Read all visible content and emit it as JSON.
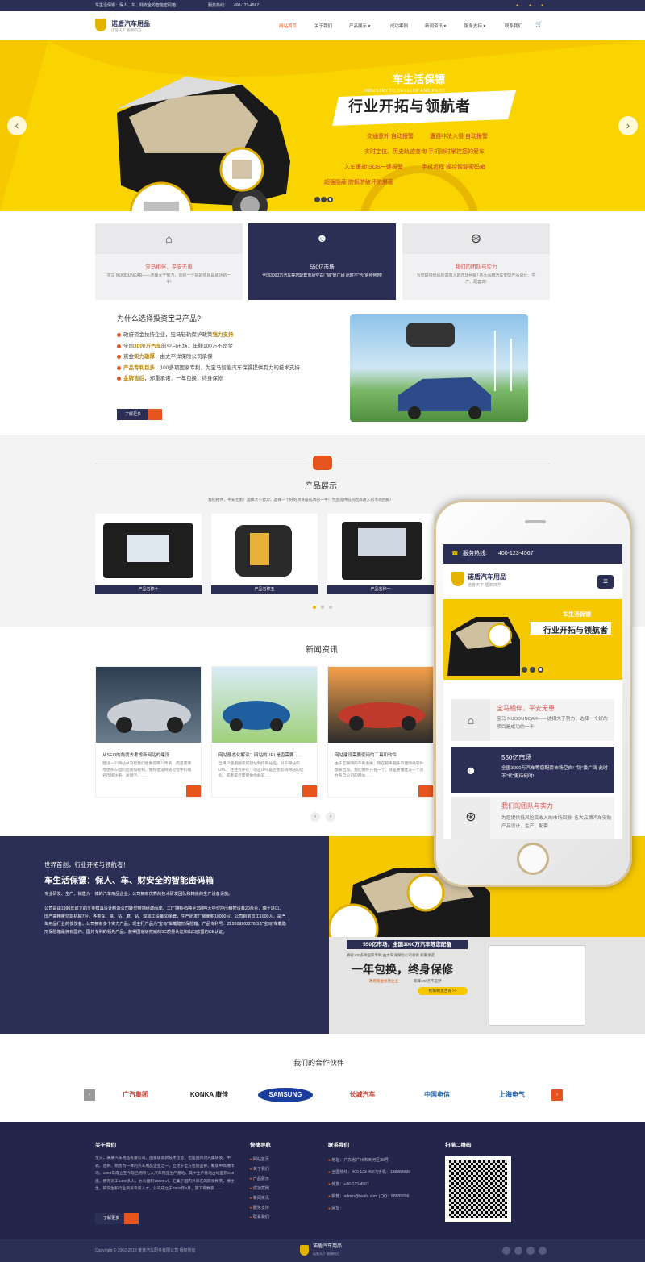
{
  "topbar": {
    "slogan": "车生活保镖：保人、车、财安全的智能密码箱！",
    "hotline_label": "服务热线：",
    "hotline": "400-123-4567"
  },
  "header": {
    "logo_title": "诺盾汽车用品",
    "logo_sub": "诺誉天下 盾御四方"
  },
  "nav": [
    {
      "label": "网站首页"
    },
    {
      "label": "关于我们"
    },
    {
      "label": "产品展示 ▾"
    },
    {
      "label": "成功案例"
    },
    {
      "label": "新闻资讯 ▾"
    },
    {
      "label": "服务支持 ▾"
    },
    {
      "label": "联系我们"
    }
  ],
  "banner": {
    "tag": "车生活保镖",
    "en": "INDUSTRY TO DEVELOP AND PILOT",
    "headline": "行业开拓与领航者",
    "features": [
      "交通意外 自动报警",
      "遭遇非法入侵 自动报警",
      "实时定位、历史轨迹查询",
      "手机随时掌控您的爱车",
      "入车遭劫 SOS一键报警",
      "手机远程 操控智能密码箱",
      "超强隐蔽 防拆防破坏防屏蔽"
    ],
    "current_slide": 3,
    "slide_count": 3
  },
  "features": [
    {
      "title": "宝马相伴，平安无患",
      "text": "宝马 NUODUNCAR——选择大于努力，选择一个好的项目是成功的一半!"
    },
    {
      "title": "550亿市场",
      "text": "全国3000万汽车等您配套市场空白! \"钱\"景广阔 此时不\"代\"更待何时!"
    },
    {
      "title": "我们的团队与实力",
      "text": "为您提供低风险高收入的市场回报! 各大品牌汽车安防产品设计、生产、配套商!"
    }
  ],
  "why": {
    "title": "为什么选择投资宝马产品?",
    "items": [
      {
        "pre": "政府资金扶持企业，宝马轻轨保护政策",
        "hl": "强力支持",
        "post": ""
      },
      {
        "pre": "全国",
        "hl": "3000万汽车",
        "post": "的空白市场，年赚100万不是梦"
      },
      {
        "pre": "资金",
        "hl": "实力雄厚",
        "post": "，由太平洋保险公司承保"
      },
      {
        "pre": "",
        "hl": "产品专利巨多",
        "post": "，100多项国家专利，为宝马智能汽车保镖提供有力的技术支持"
      },
      {
        "pre": "",
        "hl": "金牌售后",
        "post": "，郑重承诺：一年包换，终身保修"
      }
    ],
    "button": "了解更多"
  },
  "products": {
    "title": "产品展示",
    "intro": "我们相伴，平安无患！选择大于努力，选择一个好的项目是成功的一半！为您提供低风险高收入的市场回报！",
    "items": [
      {
        "name": "产品名称十"
      },
      {
        "name": "产品名称五"
      },
      {
        "name": "产品名称一"
      }
    ]
  },
  "news": {
    "title": "新闻资讯",
    "items": [
      {
        "title": "从SEO的角度去考虑新网站的建设",
        "text": "建设一个网站并没有我们想象得那么简单，而是需要考虑多方面的因素和规划。做好建设网站过程中的域名选择注册、关键字、……"
      },
      {
        "title": "网站静态化解读：网站的URL是否需要……",
        "text": "当用户使用搜索或建站制作网站后，对于网站的URL，往往会存在：动态URL是否会影响网站的优化，或者是否需要做伪静态……"
      },
      {
        "title": "网站建设需要使用的工具和软件",
        "text": "由于互联网的不断发展，现在越来越多的建网站软件都被出现。我们做好只有一个，就是要懂建设一个适合各自公司的网站……"
      }
    ]
  },
  "about": {
    "line1": "世界首创，行业开拓与领航者！",
    "line2": "车生活保镖：保人、车、财安全的智能密码箱",
    "p1": "专业研发、生产、销售为一体的汽车用品企业，公司拥有优秀的技术研发团队和精良的生产设备设施。",
    "p2": "公司是由1996年成立的五金模具设计制造公司转型带领组建而成。工厂拥有45吨至350吨大中型冲压精密设备20余台，瑞士进口、国产高精度切割机械7台，各类车、铣、钻、磨、钻、焊加工设备60余套，生产研发厂房面积10000㎡。公司目前员工1000人，是汽车用品行业的佼佼者。公司拥有多个实力产品，现主打产品为\"宝马\"车载隐形保险箱。产品专利号：ZL2009202276 3.1\"宝马\"车载隐形保险箱是拥有国内、国外专利的领先产品，获得国家级权威的3C质量认证和出口欧盟的CE认证。",
    "promo_big": "550亿市场，全国3000万汽车等您配备",
    "promo_line1": "一年包换，终身保修",
    "promo_small": "拥有100多项国家专利 由太平洋保险公司承保 郑重承诺",
    "promo_fund": "政府资金扶持企业",
    "promo_goal": "年赚100万不是梦",
    "promo_btn": "经销/批发咨询 >>"
  },
  "partners": {
    "title": "我们的合作伙伴",
    "items": [
      "广汽集团",
      "KONKA 康佳",
      "SAMSUNG",
      "长城汽车",
      "中国电信",
      "上海电气"
    ]
  },
  "footer": {
    "about_title": "关于我们",
    "about_text": "宝马，某某汽车用品有限公司，国家级高新技术企业，也是国内领先集研发、中式、定制、销售为一体的汽车用品企业之一，立足于全方位防盗护。聚焦中高端市场，1993年成立至今现已拥有七大汽车用品生产基地，其中生产基地占地面积238亩，拥有员工1400多人，办公面积10000㎡。汇集了国内外知名的研发精英，博士生、研究生和行业资深专家人才，公司成立于2003年6月，旗下有数家……",
    "about_btn": "了解更多",
    "nav_title": "快捷导航",
    "nav": [
      "网站首页",
      "关于我们",
      "产品展示",
      "成功案例",
      "新闻资讯",
      "服务支持",
      "联系我们"
    ],
    "contact_title": "联系我们",
    "contact": [
      "地址：广东省广州市天河区88号",
      "全国热线：400-123-4567|手机：138888999",
      "传真：+86-123-4567",
      "邮箱：admin@baidu.com | QQ：88889999",
      "网址："
    ],
    "qr_title": "扫描二维码"
  },
  "copyright": "Copyright © 2002-2018 某某汽车配件有限公司 版权所有",
  "phone": {
    "hotline_label": "服务热线:",
    "hotline": "400-123-4567",
    "logo_title": "诺盾汽车用品",
    "logo_sub": "诺誉天下 盾御四方",
    "banner_tag": "车生活保镖",
    "banner_headline": "行业开拓与领航者",
    "features": [
      {
        "title": "宝马相伴，平安无患",
        "text": "宝马 NUODUNCAR——选择大于努力，选择一个好的项目是成功的一半!"
      },
      {
        "title": "550亿市场",
        "text": "全国3000万汽车等您配套市场空白! \"钱\"景广阔 此时不\"代\"更待何时!"
      },
      {
        "title": "我们的团队与实力",
        "text": "为您提供低风险高收入的市场回报! 各大品牌汽车安防产品设计、生产、配套"
      }
    ]
  },
  "colors": {
    "navy": "#2b2f55",
    "yellow": "#f6c800",
    "orange": "#e8541e",
    "red": "#d9534f"
  }
}
